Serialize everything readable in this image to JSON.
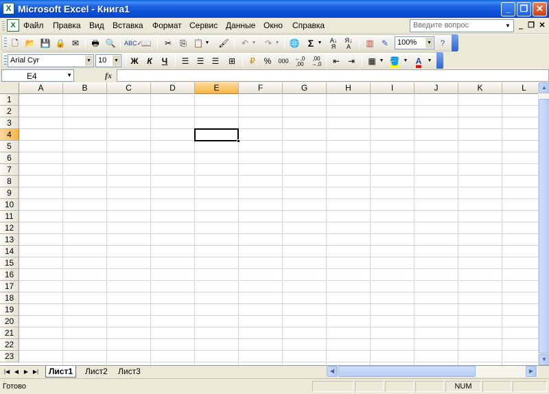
{
  "window": {
    "title": "Microsoft Excel - Книга1",
    "app_icon": "X"
  },
  "menu": {
    "items": [
      {
        "label": "Файл"
      },
      {
        "label": "Правка"
      },
      {
        "label": "Вид"
      },
      {
        "label": "Вставка"
      },
      {
        "label": "Формат"
      },
      {
        "label": "Сервис"
      },
      {
        "label": "Данные"
      },
      {
        "label": "Окно"
      },
      {
        "label": "Справка"
      }
    ],
    "help_placeholder": "Введите вопрос"
  },
  "standard_toolbar": {
    "zoom": "100%",
    "icons": [
      "new-icon",
      "open-icon",
      "save-icon",
      "permission-icon",
      "email-icon",
      "print-icon",
      "print-preview-icon",
      "spelling-icon",
      "research-icon",
      "cut-icon",
      "copy-icon",
      "paste-icon",
      "format-painter-icon",
      "undo-icon",
      "redo-icon",
      "hyperlink-icon",
      "autosum-icon",
      "sort-ascending-icon",
      "sort-descending-icon",
      "chart-wizard-icon",
      "drawing-icon",
      "help-icon"
    ]
  },
  "formatting_toolbar": {
    "font_name": "Arial Cyr",
    "font_size": "10",
    "bold_label": "Ж",
    "italic_label": "К",
    "underline_label": "Ч",
    "percent_label": "%",
    "thousands_label": "000",
    "font_color": "#ff0000",
    "fill_color": "#ffff00"
  },
  "formula_bar": {
    "name_box": "E4",
    "fx": "fx",
    "formula": ""
  },
  "grid": {
    "columns": [
      "A",
      "B",
      "C",
      "D",
      "E",
      "F",
      "G",
      "H",
      "I",
      "J",
      "K",
      "L"
    ],
    "rows": [
      "1",
      "2",
      "3",
      "4",
      "5",
      "6",
      "7",
      "8",
      "9",
      "10",
      "11",
      "12",
      "13",
      "14",
      "15",
      "16",
      "17",
      "18",
      "19",
      "20",
      "21",
      "22",
      "23"
    ],
    "active_column": "E",
    "active_row": "4"
  },
  "sheets": {
    "tabs": [
      "Лист1",
      "Лист2",
      "Лист3"
    ],
    "active": "Лист1"
  },
  "status": {
    "text": "Готово",
    "num_indicator": "NUM"
  }
}
